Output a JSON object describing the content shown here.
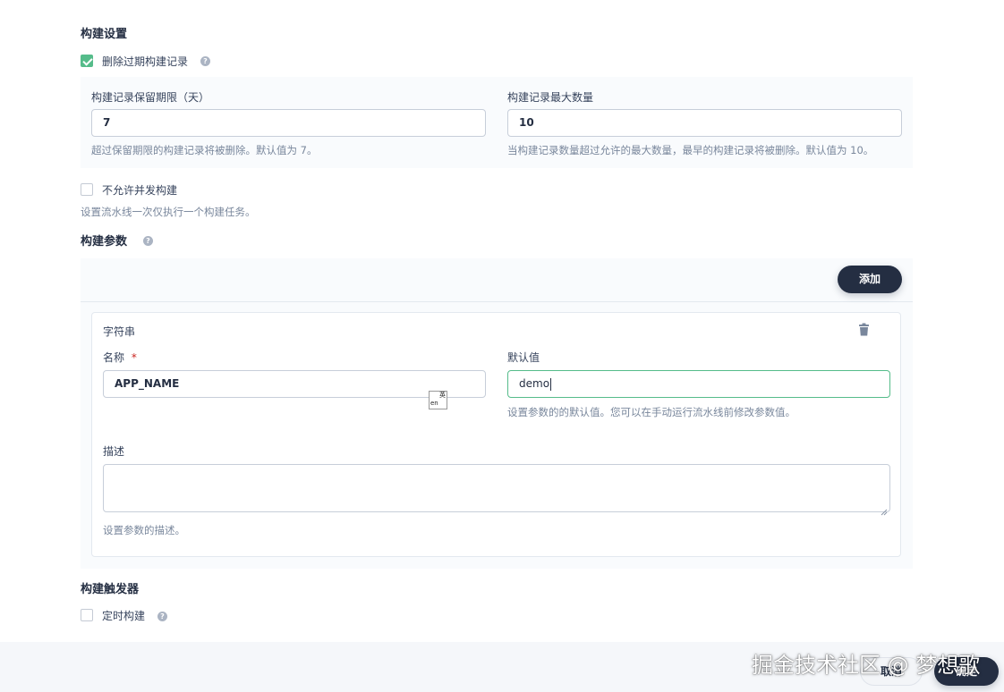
{
  "build_settings": {
    "title": "构建设置",
    "discard_old": {
      "label": "删除过期构建记录",
      "checked": true
    },
    "days_to_keep": {
      "label": "构建记录保留期限（天）",
      "value": "7",
      "desc": "超过保留期限的构建记录将被删除。默认值为 7。"
    },
    "num_to_keep": {
      "label": "构建记录最大数量",
      "value": "10",
      "desc": "当构建记录数量超过允许的最大数量，最早的构建记录将被删除。默认值为 10。"
    },
    "no_concurrent": {
      "label": "不允许并发构建",
      "checked": false,
      "desc": "设置流水线一次仅执行一个构建任务。"
    }
  },
  "build_params": {
    "title": "构建参数",
    "add_label": "添加",
    "param": {
      "type": "字符串",
      "name_label": "名称",
      "required_mark": "*",
      "name_value": "APP_NAME",
      "default_label": "默认值",
      "default_value": "demo",
      "default_desc": "设置参数的的默认值。您可以在手动运行流水线前修改参数值。",
      "desc_label": "描述",
      "desc_value": "",
      "desc_hint": "设置参数的描述。"
    }
  },
  "build_triggers": {
    "title": "构建触发器",
    "timer": {
      "label": "定时构建",
      "checked": false
    }
  },
  "footer": {
    "cancel_label": "取消",
    "ok_label": "确定"
  },
  "watermark": "掘金技术社区 @ 梦想歌",
  "help_glyph": "?",
  "ime_indicator": {
    "top": "英",
    "bottom": "en"
  },
  "colors": {
    "accent": "#55bc8a",
    "primary_dark": "#242e42"
  }
}
